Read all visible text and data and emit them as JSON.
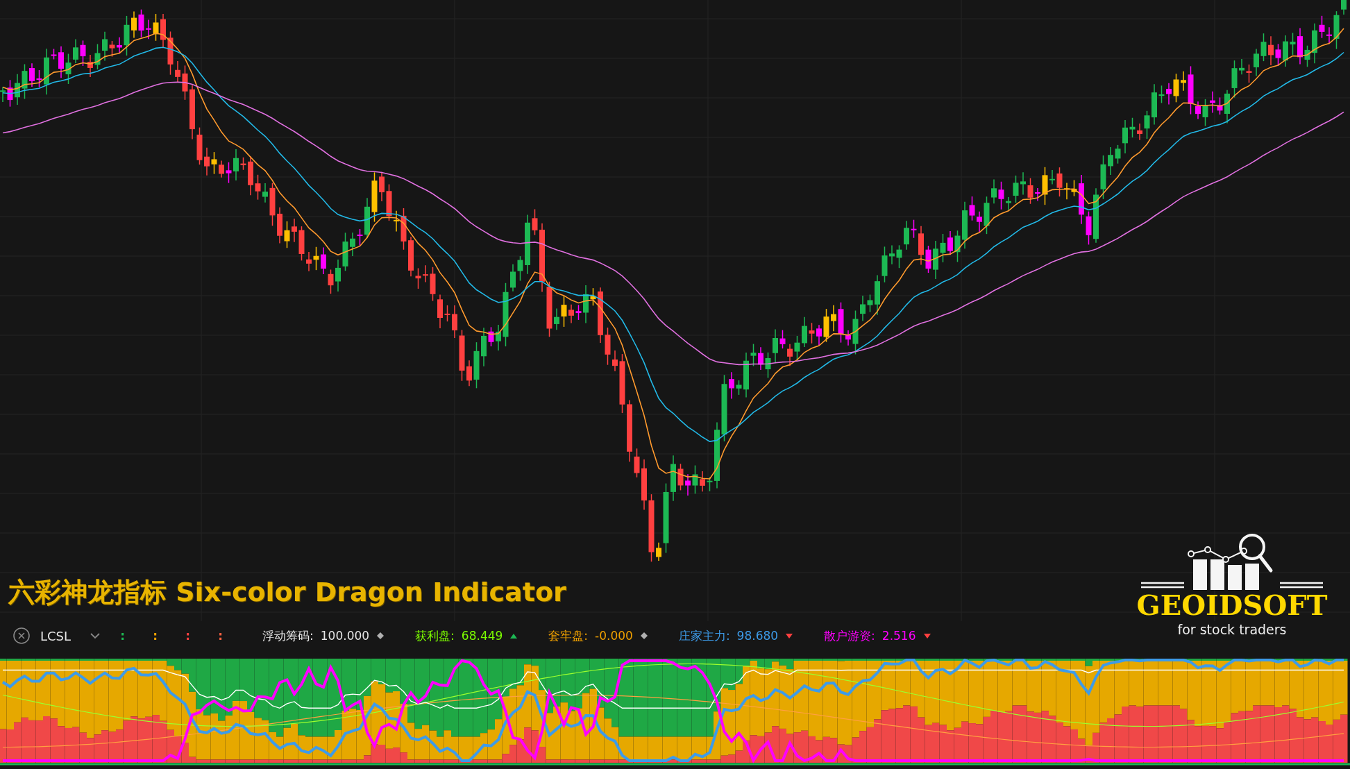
{
  "title": "六彩神龙指标 Six-color Dragon Indicator",
  "logo": {
    "name": "GEOIDSOFT",
    "tagline": "for stock traders"
  },
  "legend": {
    "name": "LCSL",
    "separators": [
      {
        "text": ":",
        "color": "#1db954"
      },
      {
        "text": ":",
        "color": "#f0a000"
      },
      {
        "text": ":",
        "color": "#ff4040"
      },
      {
        "text": ":",
        "color": "#ff6040"
      }
    ],
    "items": [
      {
        "label": "浮动筹码:",
        "value": "100.000",
        "kind": "diamond",
        "color": "#e6e6e6"
      },
      {
        "label": "获利盘:",
        "value": "68.449",
        "kind": "up",
        "color": "#7cfc00"
      },
      {
        "label": "套牢盘:",
        "value": "-0.000",
        "kind": "diamond",
        "color": "#f0a000"
      },
      {
        "label": "庄家主力:",
        "value": "98.680",
        "kind": "down",
        "color": "#3d9be9"
      },
      {
        "label": "散户游资:",
        "value": "2.516",
        "kind": "down",
        "color": "#ff00ff"
      }
    ]
  }
}
